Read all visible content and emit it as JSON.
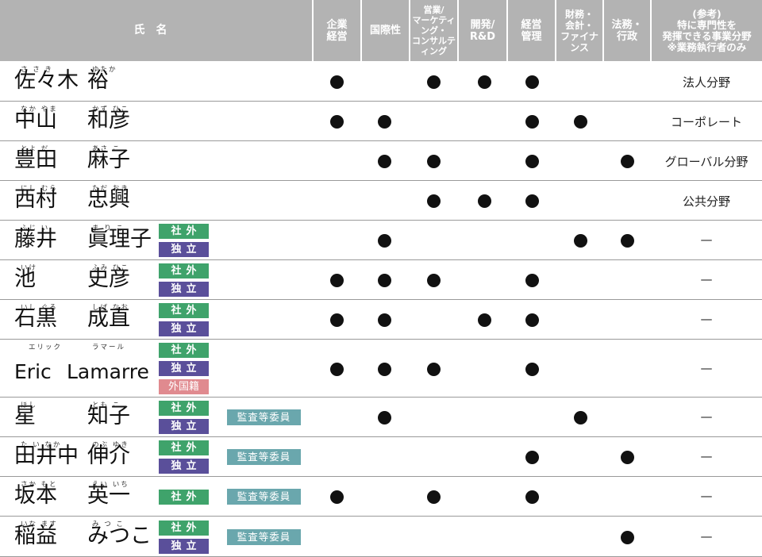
{
  "header": {
    "name": "氏名",
    "skills": [
      "企業\n経営",
      "国際性",
      "営業/\nマーケティング・\nコンサルティング",
      "開発/\nR&D",
      "経営\n管理",
      "財務・\n会計・\nファイナンス",
      "法務・\n行政"
    ],
    "reference": "(参考)\n特に専門性を\n発揮できる事業分野\n※業務執行者のみ"
  },
  "labels": {
    "outside": "社外",
    "independent": "独立",
    "foreign": "外国籍",
    "committee": "監査等委員"
  },
  "dot_color": "#111111",
  "badge_colors": {
    "outside": "#3fa36b",
    "independent": "#5a4f9a",
    "foreign": "#e08a8f",
    "committee": "#6aa7ad"
  },
  "rows": [
    {
      "ruby_family": "さ さ き",
      "ruby_given": "ゆたか",
      "family": "佐々木",
      "given": "裕",
      "badges": [],
      "committee": false,
      "skills": [
        1,
        0,
        1,
        1,
        1,
        0,
        0
      ],
      "reference": "法人分野"
    },
    {
      "ruby_family": "なか やま",
      "ruby_given": "かず ひこ",
      "family": "中山",
      "given": "和彦",
      "badges": [],
      "committee": false,
      "skills": [
        1,
        1,
        0,
        0,
        1,
        1,
        0
      ],
      "reference": "コーポレート"
    },
    {
      "ruby_family": "とよ だ",
      "ruby_given": "あさ こ",
      "family": "豊田",
      "given": "麻子",
      "badges": [],
      "committee": false,
      "skills": [
        0,
        1,
        1,
        0,
        1,
        0,
        1
      ],
      "reference": "グローバル分野"
    },
    {
      "ruby_family": "にし むら",
      "ruby_given": "ただ おき",
      "family": "西村",
      "given": "忠興",
      "badges": [],
      "committee": false,
      "skills": [
        0,
        0,
        1,
        1,
        1,
        0,
        0
      ],
      "reference": "公共分野"
    },
    {
      "ruby_family": "ふじ い",
      "ruby_given": "ま り こ",
      "family": "藤井",
      "given": "眞理子",
      "badges": [
        "outside",
        "independent"
      ],
      "committee": false,
      "skills": [
        0,
        1,
        0,
        0,
        0,
        1,
        1
      ],
      "reference": "—"
    },
    {
      "ruby_family": "いけ",
      "ruby_given": "ふみ ひこ",
      "family": "池",
      "given": "史彦",
      "badges": [
        "outside",
        "independent"
      ],
      "committee": false,
      "skills": [
        1,
        1,
        1,
        0,
        1,
        0,
        0
      ],
      "reference": "—"
    },
    {
      "ruby_family": "いし ぐろ",
      "ruby_given": "しげ なお",
      "family": "石黒",
      "given": "成直",
      "badges": [
        "outside",
        "independent"
      ],
      "committee": false,
      "skills": [
        1,
        1,
        0,
        1,
        1,
        0,
        0
      ],
      "reference": "—"
    },
    {
      "ruby_family": "エリック",
      "ruby_given": "ラマール",
      "family": "Eric",
      "given": "Lamarre",
      "badges": [
        "outside",
        "independent",
        "foreign"
      ],
      "committee": false,
      "skills": [
        1,
        1,
        1,
        0,
        1,
        0,
        0
      ],
      "reference": "—",
      "latin": true
    },
    {
      "ruby_family": "ほし",
      "ruby_given": "とも こ",
      "family": "星",
      "given": "知子",
      "badges": [
        "outside",
        "independent"
      ],
      "committee": true,
      "skills": [
        0,
        1,
        0,
        0,
        0,
        1,
        0
      ],
      "reference": "—"
    },
    {
      "ruby_family": "た い なか",
      "ruby_given": "のぶ ゆき",
      "family": "田井中",
      "given": "伸介",
      "badges": [
        "outside",
        "independent"
      ],
      "committee": true,
      "skills": [
        0,
        0,
        0,
        0,
        1,
        0,
        1
      ],
      "reference": "—"
    },
    {
      "ruby_family": "さか もと",
      "ruby_given": "えい いち",
      "family": "坂本",
      "given": "英一",
      "badges": [
        "outside"
      ],
      "committee": true,
      "skills": [
        1,
        0,
        1,
        0,
        1,
        0,
        0
      ],
      "reference": "—"
    },
    {
      "ruby_family": "いな ます",
      "ruby_given": "み つ こ",
      "family": "稲益",
      "given": "みつこ",
      "badges": [
        "outside",
        "independent"
      ],
      "committee": true,
      "skills": [
        0,
        0,
        0,
        0,
        0,
        0,
        1
      ],
      "reference": "—"
    }
  ]
}
